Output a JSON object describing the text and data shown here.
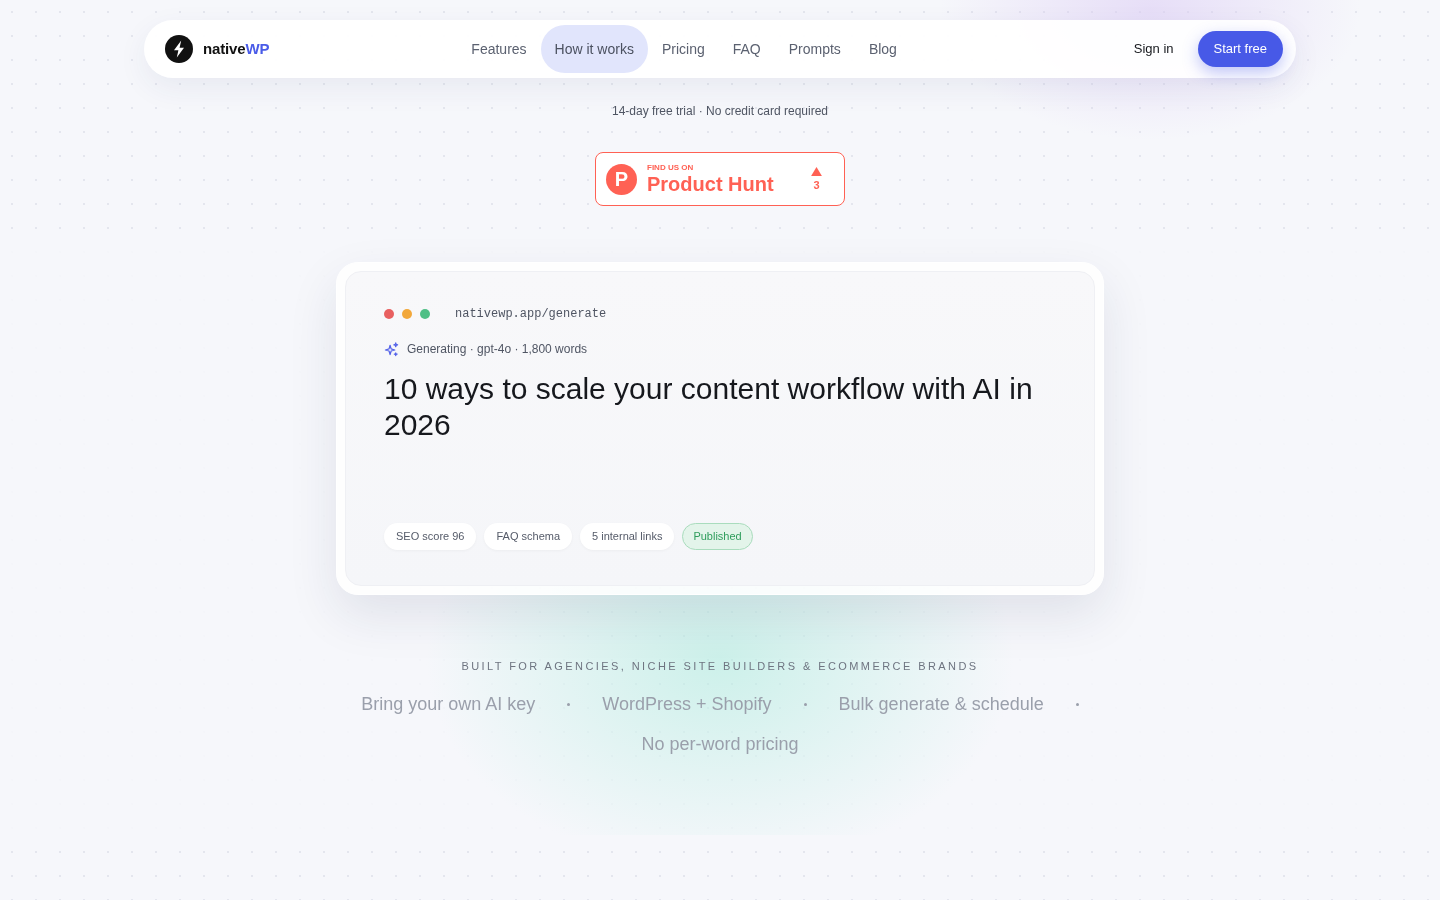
{
  "brand": {
    "name": "native",
    "accent": "WP"
  },
  "nav": {
    "links": [
      {
        "label": "Features",
        "selected": false
      },
      {
        "label": "How it works",
        "selected": true
      },
      {
        "label": "Pricing",
        "selected": false
      },
      {
        "label": "FAQ",
        "selected": false
      },
      {
        "label": "Prompts",
        "selected": false
      },
      {
        "label": "Blog",
        "selected": false
      }
    ],
    "sign_in": "Sign in",
    "cta": "Start free"
  },
  "tagline": "14-day free trial · No credit card required",
  "product_hunt": {
    "logo_letter": "P",
    "eyebrow": "FIND US ON",
    "title": "Product Hunt",
    "votes": "3"
  },
  "preview": {
    "url": "nativewp.app/generate",
    "status": "Generating · gpt-4o · 1,800 words",
    "headline": "10 ways to scale your content workflow with AI in 2026",
    "tags": [
      {
        "label": "SEO score 96",
        "kind": "chip"
      },
      {
        "label": "FAQ schema",
        "kind": "chip"
      },
      {
        "label": "5 internal links",
        "kind": "chip"
      },
      {
        "label": "Published",
        "kind": "status"
      }
    ]
  },
  "audience": {
    "heading": "BUILT FOR AGENCIES, NICHE SITE BUILDERS & ECOMMERCE BRANDS",
    "features": [
      "Bring your own AI key",
      "WordPress + Shopify",
      "Bulk generate & schedule",
      "No per-word pricing"
    ]
  }
}
